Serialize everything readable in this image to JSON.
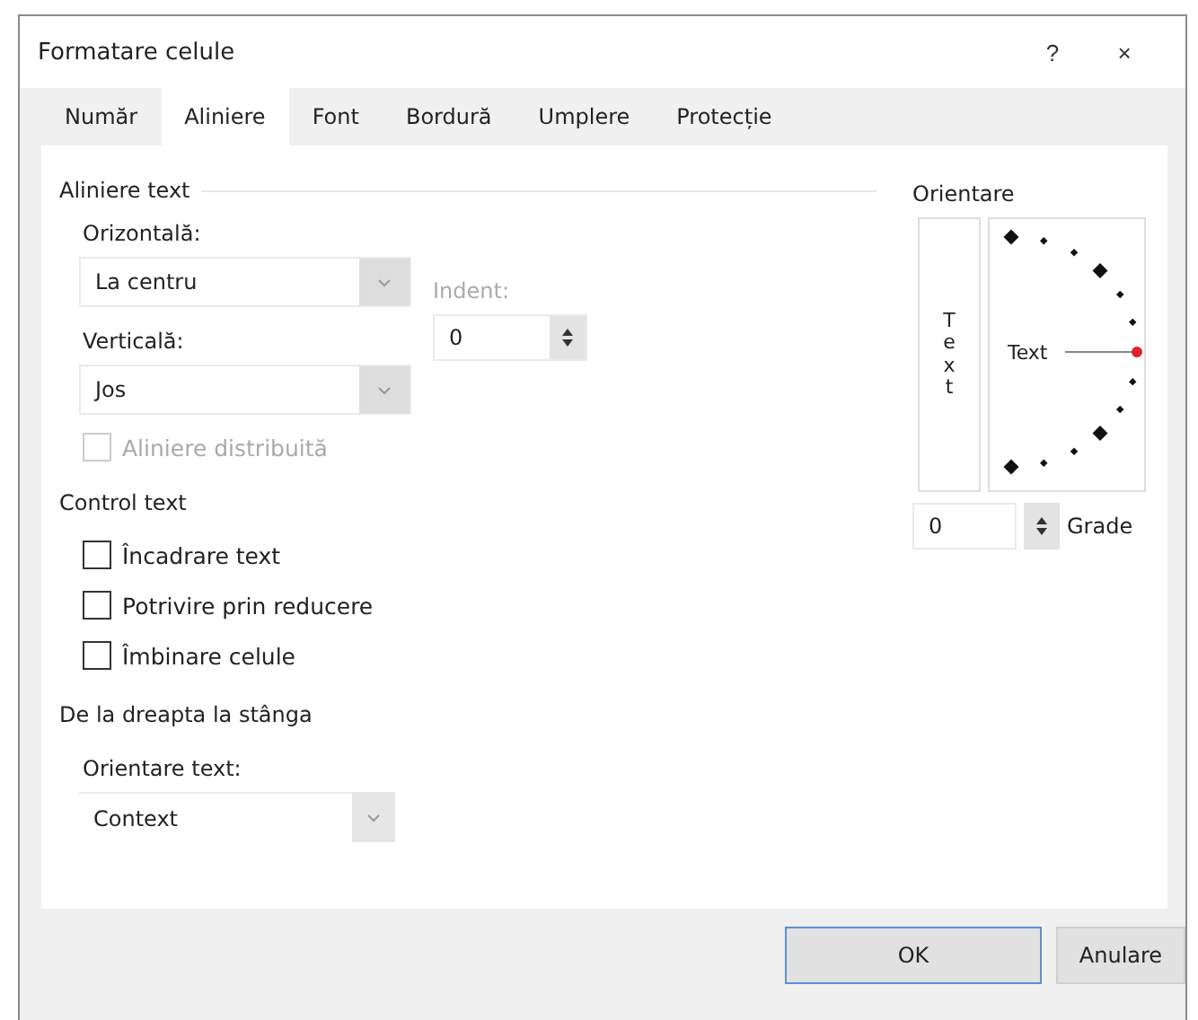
{
  "window": {
    "title": "Formatare celule",
    "help": "?",
    "close": "×"
  },
  "tabs": [
    {
      "label": "Număr",
      "selected": false
    },
    {
      "label": "Aliniere",
      "selected": true
    },
    {
      "label": "Font",
      "selected": false
    },
    {
      "label": "Bordură",
      "selected": false
    },
    {
      "label": "Umplere",
      "selected": false
    },
    {
      "label": "Protecție",
      "selected": false
    }
  ],
  "text_alignment": {
    "title": "Aliniere text",
    "horizontal_label": "Orizontală:",
    "horizontal_value": "La centru",
    "vertical_label": "Verticală:",
    "vertical_value": "Jos",
    "indent_label": "Indent:",
    "indent_value": "0",
    "distributed": {
      "label": "Aliniere distribuită",
      "checked": false,
      "disabled": true
    }
  },
  "text_control": {
    "title": "Control text",
    "options": [
      {
        "label": "Încadrare text",
        "checked": false
      },
      {
        "label": "Potrivire prin reducere",
        "checked": false
      },
      {
        "label": "Îmbinare celule",
        "checked": false
      }
    ]
  },
  "right_to_left": {
    "title": "De la dreapta la stânga",
    "direction_label": "Orientare text:",
    "direction_value": "Context"
  },
  "orientation": {
    "title": "Orientare",
    "vertical_text": "Text",
    "dial_text": "Text",
    "degrees_value": "0",
    "degrees_label": "Grade"
  },
  "buttons": [
    {
      "label": "OK",
      "selected": true
    },
    {
      "label": "Anulare",
      "selected": false
    }
  ]
}
